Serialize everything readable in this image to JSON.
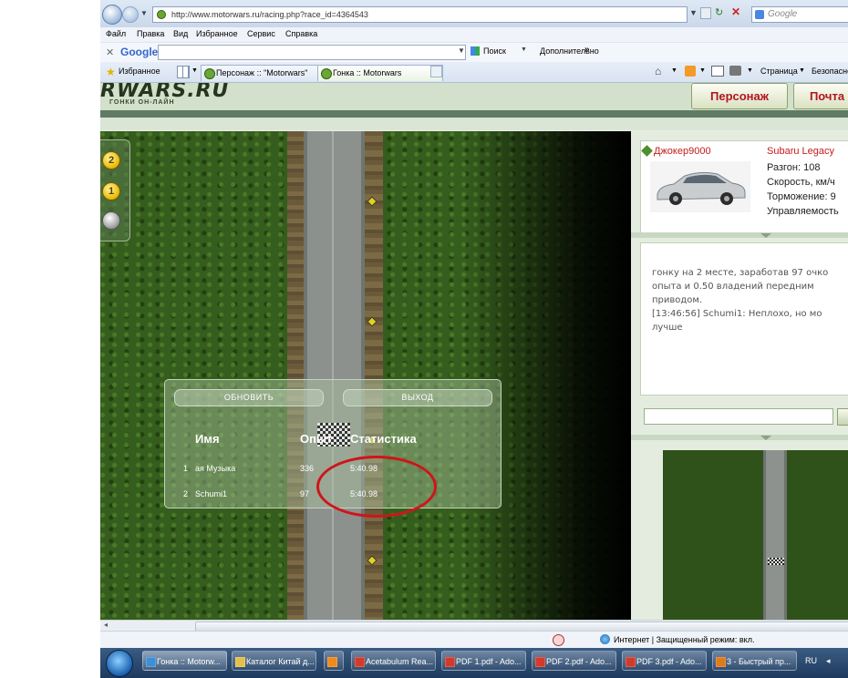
{
  "browser": {
    "url": "http://www.motorwars.ru/racing.php?race_id=4364543",
    "search_placeholder": "Google",
    "menu": [
      "Файл",
      "Правка",
      "Вид",
      "Избранное",
      "Сервис",
      "Справка"
    ],
    "google_bar": {
      "label": "Google",
      "search_button": "Поиск",
      "more": "Дополнительно"
    },
    "favorites": "Избранное",
    "tabs": [
      "Персонаж :: \"Motorwars\"",
      "Гонка :: Motorwars"
    ],
    "tools": {
      "page": "Страница",
      "safety": "Безопасно"
    }
  },
  "site": {
    "logo": "RWARS.RU",
    "logo_sub": "ГОНКИ ОН-ЛАЙН",
    "nav": [
      "Персонаж",
      "Почта"
    ]
  },
  "race": {
    "positions": [
      "2",
      "1",
      ""
    ],
    "results": {
      "refresh_button": "ОБНОВИТЬ",
      "exit_button": "ВЫХОД",
      "headers": {
        "name": "Имя",
        "points": "Опыт",
        "stats": "Статистика"
      },
      "rows": [
        {
          "place": "1",
          "name": "ая Музыка",
          "points": "336",
          "time": "5:40.98"
        },
        {
          "place": "2",
          "name": "Schumi1",
          "points": "97",
          "time": "5:40.98"
        }
      ]
    }
  },
  "player": {
    "name": "Джокер9000",
    "car": "Subaru Legacy",
    "stats": [
      "Разгон: 108",
      "Скорость, км/ч",
      "Торможение: 9",
      "Управляемость"
    ]
  },
  "chat": {
    "text": "гонку на 2 месте, заработав 97 очко\nопыта и 0.50 владений передним\nприводом.\n[13:46:56] Schumi1: Неплохо, но мо\nлучше"
  },
  "status": {
    "zone": "Интернет | Защищенный режим: вкл."
  },
  "taskbar": {
    "items": [
      "Гонка :: Motorw...",
      "Каталог Китай д...",
      "",
      "Acetabulum Rea...",
      "PDF 1.pdf - Ado...",
      "PDF 2.pdf - Ado...",
      "PDF 3.pdf - Ado...",
      "3 - Быстрый пр..."
    ],
    "lang": "RU"
  }
}
